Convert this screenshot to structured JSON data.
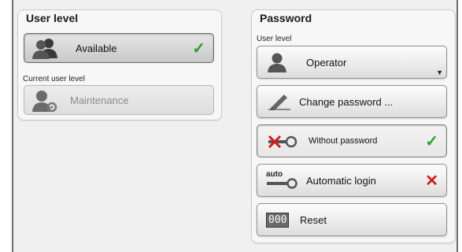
{
  "user_level_panel": {
    "title": "User level",
    "available_button": {
      "label": "Available",
      "state": "check"
    },
    "current_label": "Current user level",
    "current_button": {
      "label": "Maintenance"
    }
  },
  "password_panel": {
    "title": "Password",
    "user_level_label": "User level",
    "user_level_select": {
      "value": "Operator"
    },
    "change_password_button": {
      "label": "Change password ..."
    },
    "without_password_button": {
      "label": "Without password",
      "state": "check"
    },
    "automatic_login_button": {
      "label": "Automatic login",
      "state": "cross",
      "icon_text": "auto"
    },
    "reset_button": {
      "label": "Reset",
      "icon_text": "000"
    }
  },
  "symbols": {
    "check": "✓",
    "cross": "✕"
  },
  "colors": {
    "check": "#2f9e2f",
    "cross": "#d21a1a",
    "icon_grey": "#555555"
  }
}
